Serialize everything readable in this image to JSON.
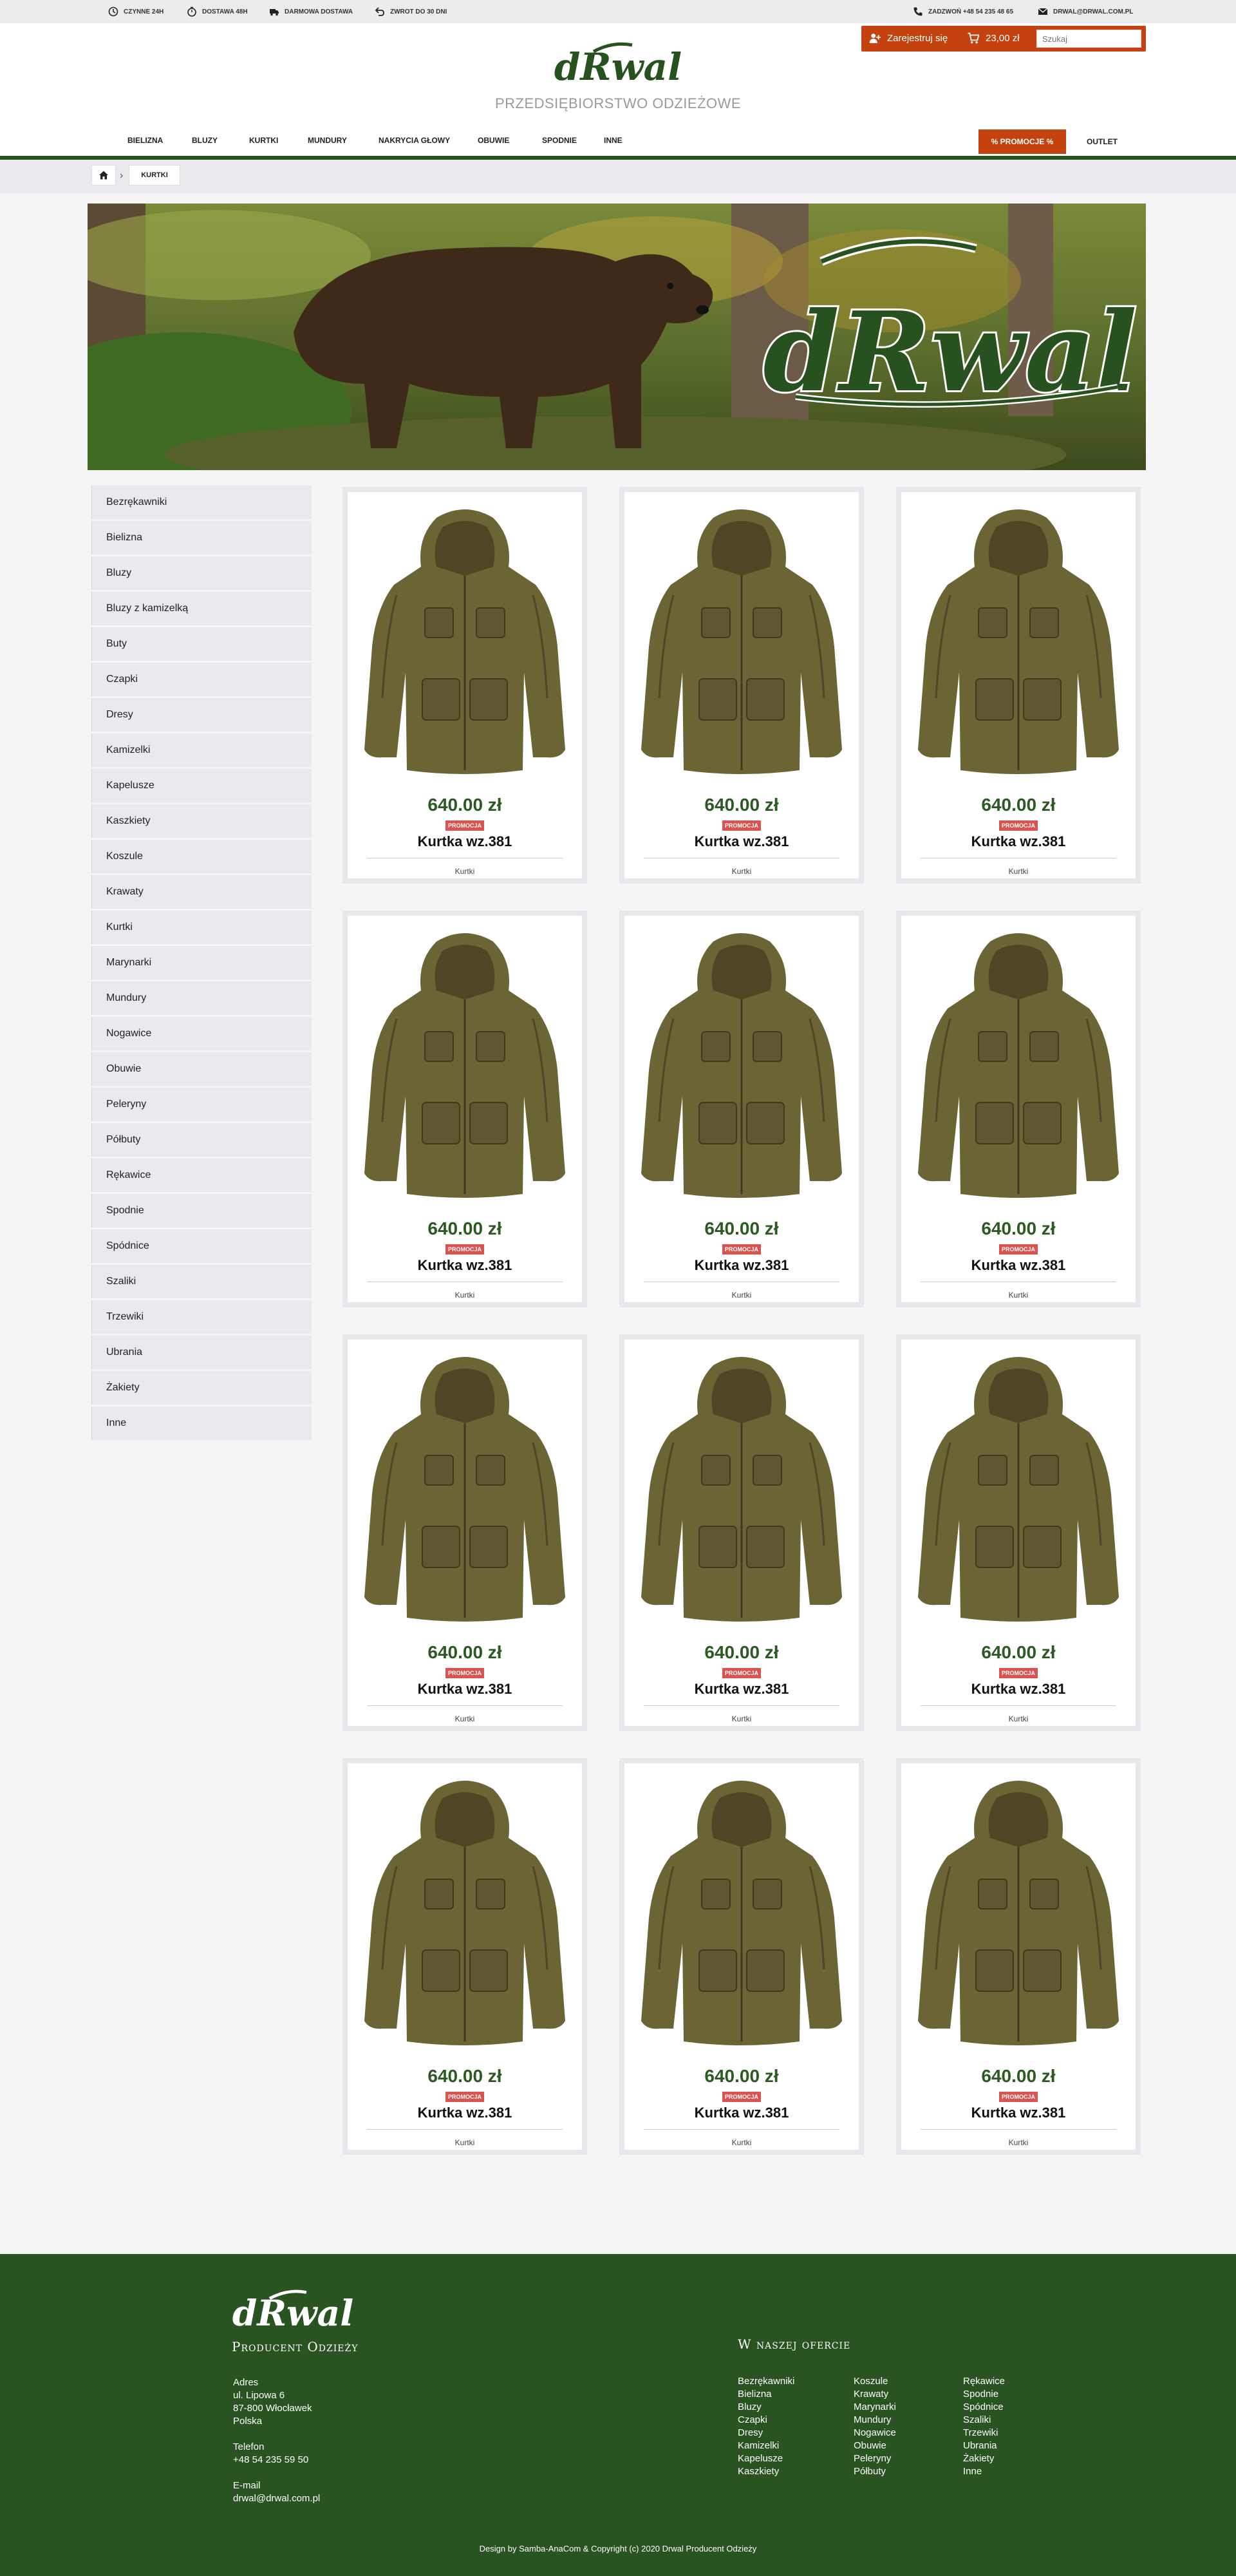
{
  "topbar": {
    "features": [
      {
        "icon": "clock-icon",
        "label": "CZYNNE 24H"
      },
      {
        "icon": "stopwatch-icon",
        "label": "DOSTAWA 48H"
      },
      {
        "icon": "truck-icon",
        "label": "DARMOWA DOSTAWA"
      },
      {
        "icon": "return-arrow-icon",
        "label": "ZWROT DO 30 DNI"
      }
    ],
    "phone": "ZADZWOŃ +48 54 235 48 65",
    "email": "DRWAL@DRWAL.COM.PL"
  },
  "userbar": {
    "register": "Zarejestruj się",
    "cart_total": "23,00 zł",
    "search_placeholder": "Szukaj"
  },
  "brand": {
    "logo_text": "dRwal",
    "subtitle": "PRZEDSIĘBIORSTWO ODZIEŻOWE",
    "green": "#27521f",
    "accent": "#c4420f"
  },
  "nav": {
    "items": [
      "BIELIZNA",
      "BLUZY",
      "KURTKI",
      "MUNDURY",
      "NAKRYCIA GŁOWY",
      "OBUWIE",
      "SPODNIE",
      "INNE"
    ],
    "promo": "% PROMOCJE %",
    "outlet": "OUTLET"
  },
  "breadcrumb": {
    "current": "KURTKI"
  },
  "banner": {
    "logo_text": "dRwal"
  },
  "sidebar": {
    "items": [
      "Bezrękawniki",
      "Bielizna",
      "Bluzy",
      "Bluzy z kamizelką",
      "Buty",
      "Czapki",
      "Dresy",
      "Kamizelki",
      "Kapelusze",
      "Kaszkiety",
      "Koszule",
      "Krawaty",
      "Kurtki",
      "Marynarki",
      "Mundury",
      "Nogawice",
      "Obuwie",
      "Peleryny",
      "Półbuty",
      "Rękawice",
      "Spodnie",
      "Spódnice",
      "Szaliki",
      "Trzewiki",
      "Ubrania",
      "Żakiety",
      "Inne"
    ]
  },
  "products": [
    {
      "price": "640.00 zł",
      "badge": "PROMOCJA",
      "name": "Kurtka wz.381",
      "category": "Kurtki"
    },
    {
      "price": "640.00 zł",
      "badge": "PROMOCJA",
      "name": "Kurtka wz.381",
      "category": "Kurtki"
    },
    {
      "price": "640.00 zł",
      "badge": "PROMOCJA",
      "name": "Kurtka wz.381",
      "category": "Kurtki"
    },
    {
      "price": "640.00 zł",
      "badge": "PROMOCJA",
      "name": "Kurtka wz.381",
      "category": "Kurtki"
    },
    {
      "price": "640.00 zł",
      "badge": "PROMOCJA",
      "name": "Kurtka wz.381",
      "category": "Kurtki"
    },
    {
      "price": "640.00 zł",
      "badge": "PROMOCJA",
      "name": "Kurtka wz.381",
      "category": "Kurtki"
    },
    {
      "price": "640.00 zł",
      "badge": "PROMOCJA",
      "name": "Kurtka wz.381",
      "category": "Kurtki"
    },
    {
      "price": "640.00 zł",
      "badge": "PROMOCJA",
      "name": "Kurtka wz.381",
      "category": "Kurtki"
    },
    {
      "price": "640.00 zł",
      "badge": "PROMOCJA",
      "name": "Kurtka wz.381",
      "category": "Kurtki"
    },
    {
      "price": "640.00 zł",
      "badge": "PROMOCJA",
      "name": "Kurtka wz.381",
      "category": "Kurtki"
    },
    {
      "price": "640.00 zł",
      "badge": "PROMOCJA",
      "name": "Kurtka wz.381",
      "category": "Kurtki"
    },
    {
      "price": "640.00 zł",
      "badge": "PROMOCJA",
      "name": "Kurtka wz.381",
      "category": "Kurtki"
    }
  ],
  "footer": {
    "logo_text": "dRwal",
    "tagline": "Producent Odzieży",
    "address_label": "Adres",
    "address_line1": "ul. Lipowa 6",
    "address_line2": "87-800 Włocławek",
    "address_line3": "Polska",
    "phone_label": "Telefon",
    "phone": "+48 54 235 59 50",
    "email_label": "E-mail",
    "email": "drwal@drwal.com.pl",
    "offer_heading": "W naszej ofercie",
    "offer_col1": [
      "Bezrękawniki",
      "Bielizna",
      "Bluzy",
      "Czapki",
      "Dresy",
      "Kamizelki",
      "Kapelusze",
      "Kaszkiety"
    ],
    "offer_col2": [
      "Koszule",
      "Krawaty",
      "Marynarki",
      "Mundury",
      "Nogawice",
      "Obuwie",
      "Peleryny",
      "Półbuty"
    ],
    "offer_col3": [
      "Rękawice",
      "Spodnie",
      "Spódnice",
      "Szaliki",
      "Trzewiki",
      "Ubrania",
      "Żakiety",
      "Inne"
    ],
    "copyright": "Design by Samba-AnaCom & Copyright (c) 2020 Drwal Producent Odzieży"
  }
}
